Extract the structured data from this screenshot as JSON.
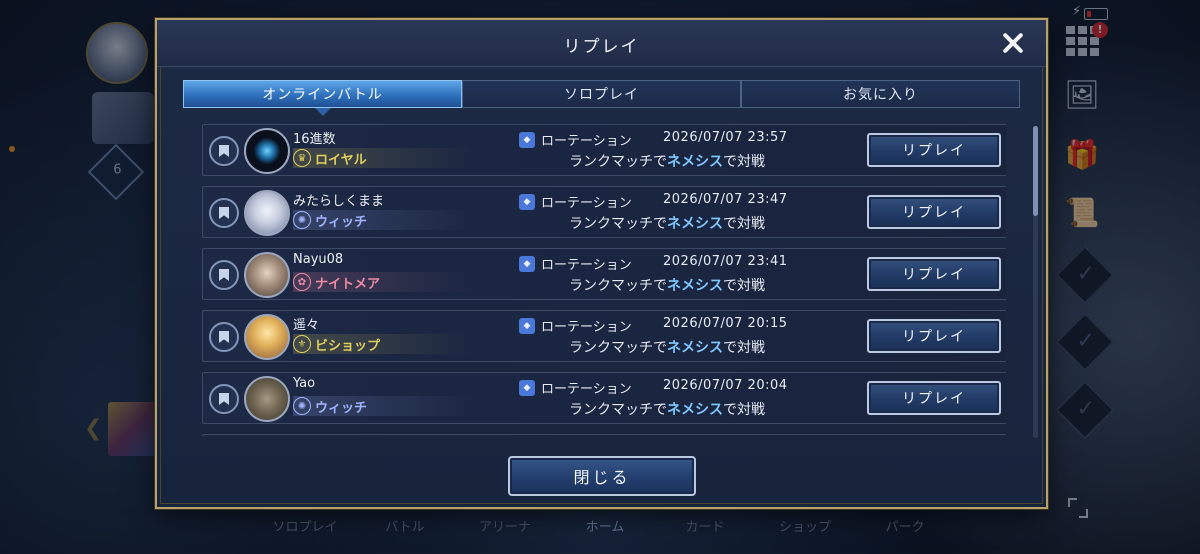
{
  "modal": {
    "title": "リプレイ",
    "close_bottom_label": "閉じる",
    "tabs": [
      {
        "label": "オンラインバトル",
        "active": true
      },
      {
        "label": "ソロプレイ",
        "active": false
      },
      {
        "label": "お気に入り",
        "active": false
      }
    ],
    "rows": [
      {
        "name": "16進数",
        "class": "ロイヤル",
        "class_color": "#e1cf5a",
        "mode": "ローテーション",
        "datetime": "2026/07/07 23:57",
        "desc_prefix": "ランクマッチで",
        "desc_highlight": "ネメシス",
        "desc_suffix": "で対戦",
        "button": "リプレイ"
      },
      {
        "name": "みたらしくまま",
        "class": "ウィッチ",
        "class_color": "#9fb4ff",
        "mode": "ローテーション",
        "datetime": "2026/07/07 23:47",
        "desc_prefix": "ランクマッチで",
        "desc_highlight": "ネメシス",
        "desc_suffix": "で対戦",
        "button": "リプレイ"
      },
      {
        "name": "Nayu08",
        "class": "ナイトメア",
        "class_color": "#f08aa6",
        "mode": "ローテーション",
        "datetime": "2026/07/07 23:41",
        "desc_prefix": "ランクマッチで",
        "desc_highlight": "ネメシス",
        "desc_suffix": "で対戦",
        "button": "リプレイ"
      },
      {
        "name": "遥々",
        "class": "ビショップ",
        "class_color": "#e1cf5a",
        "mode": "ローテーション",
        "datetime": "2026/07/07 20:15",
        "desc_prefix": "ランクマッチで",
        "desc_highlight": "ネメシス",
        "desc_suffix": "で対戦",
        "button": "リプレイ"
      },
      {
        "name": "Yao",
        "class": "ウィッチ",
        "class_color": "#9fb4ff",
        "mode": "ローテーション",
        "datetime": "2026/07/07 20:04",
        "desc_prefix": "ランクマッチで",
        "desc_highlight": "ネメシス",
        "desc_suffix": "で対戦",
        "button": "リプレイ"
      }
    ]
  },
  "background": {
    "level": "6",
    "bottom_nav": [
      "ソロプレイ",
      "バトル",
      "アリーナ",
      "ホーム",
      "カード",
      "ショップ",
      "パーク"
    ],
    "active_nav": "ホーム"
  },
  "colors": {
    "accent": "#2f71bd",
    "frame_gold": "#b7a26a",
    "highlight_text": "#7fc8ff"
  }
}
